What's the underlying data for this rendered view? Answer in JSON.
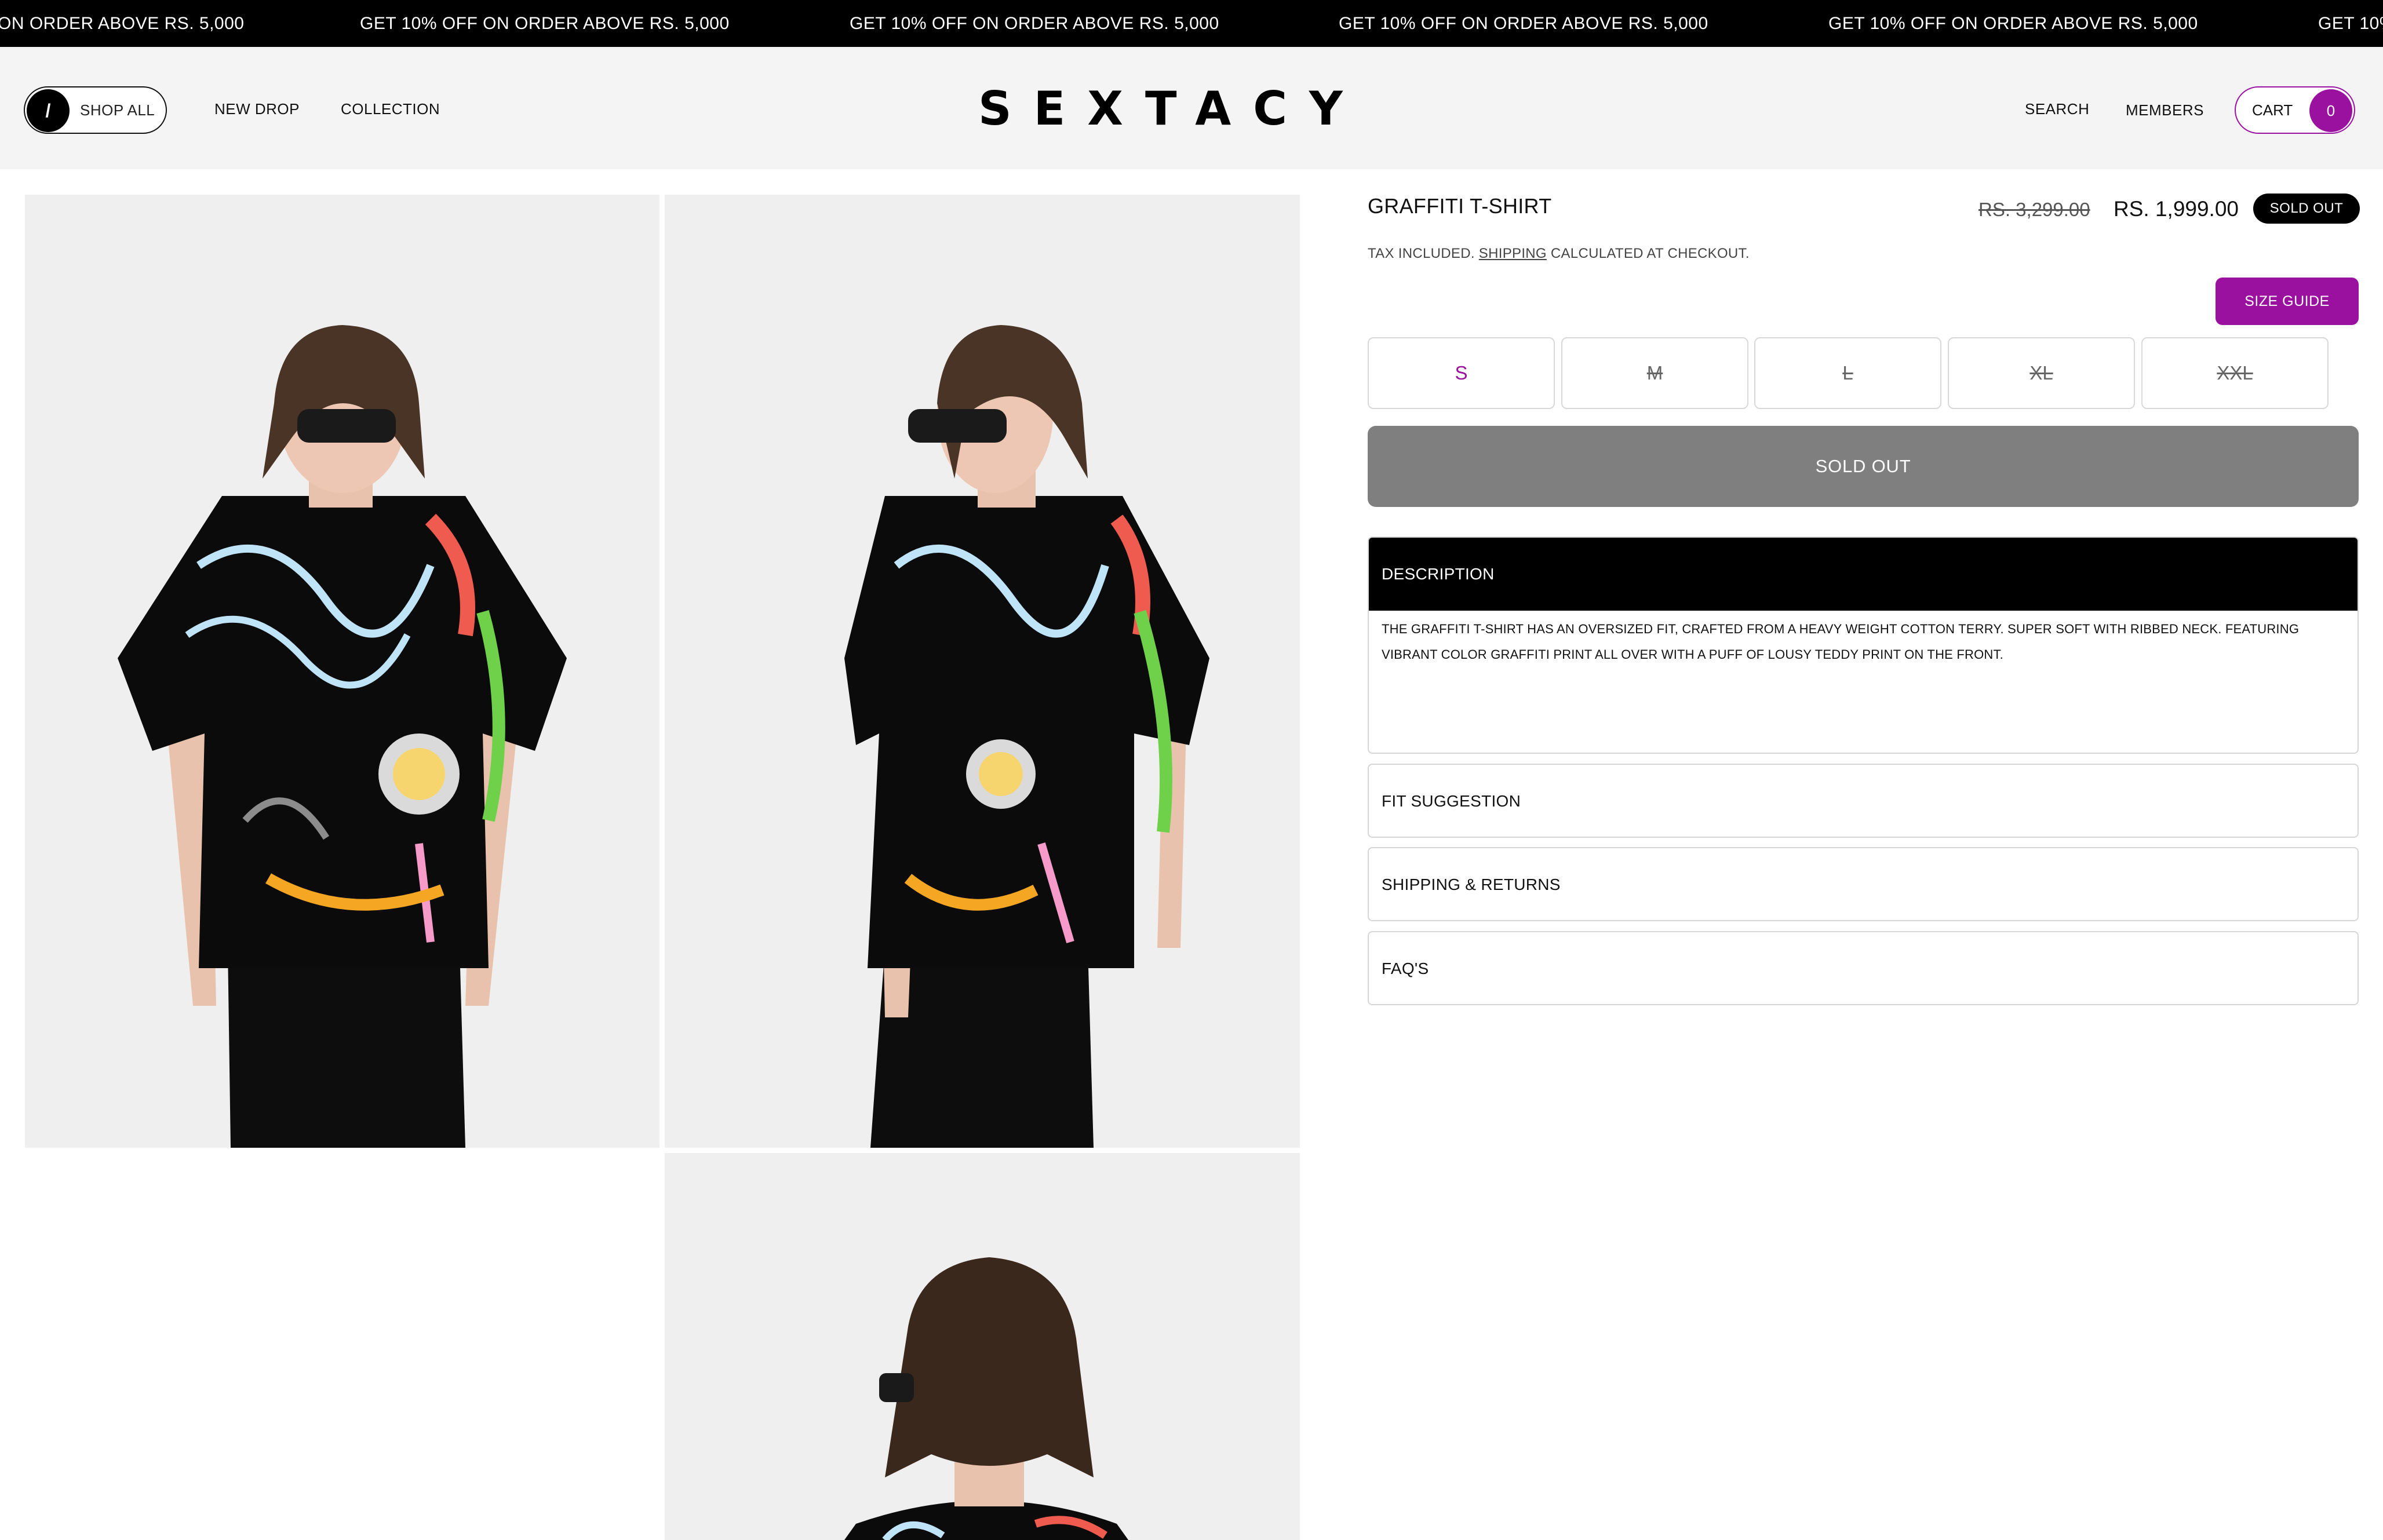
{
  "announcement": {
    "items": [
      "ON ORDER ABOVE RS. 5,000",
      "GET 10% OFF ON ORDER ABOVE RS. 5,000",
      "GET 10% OFF ON ORDER ABOVE RS. 5,000",
      "GET 10% OFF ON ORDER ABOVE RS. 5,000",
      "GET 10% OFF ON ORDER ABOVE RS. 5,000",
      "GET 10%"
    ]
  },
  "header": {
    "shop_all_icon": "/",
    "shop_all_label": "SHOP ALL",
    "nav": [
      "NEW DROP",
      "COLLECTION"
    ],
    "logo": "SEXTACY",
    "search_label": "SEARCH",
    "members_label": "MEMBERS",
    "cart_label": "CART",
    "cart_count": "0"
  },
  "product": {
    "title": "GRAFFITI T-SHIRT",
    "price_old": "RS. 3,299.00",
    "price_new": "RS. 1,999.00",
    "badge": "SOLD OUT",
    "tax_prefix": "TAX INCLUDED.",
    "tax_link": "SHIPPING",
    "tax_suffix": "CALCULATED AT CHECKOUT.",
    "size_guide_label": "SIZE GUIDE",
    "sizes": [
      "S",
      "M",
      "L",
      "XL",
      "XXL"
    ],
    "selected_size": "S",
    "sold_out_button": "SOLD OUT"
  },
  "accordion": {
    "description_title": "DESCRIPTION",
    "description_line1": "THE GRAFFITI T-SHIRT HAS AN OVERSIZED FIT, CRAFTED FROM A HEAVY WEIGHT COTTON TERRY. SUPER SOFT WITH RIBBED NECK. FEATURING",
    "description_line2": "VIBRANT COLOR GRAFFITI PRINT ALL OVER WITH A PUFF OF LOUSY TEDDY PRINT ON THE FRONT.",
    "fit_title": "FIT SUGGESTION",
    "shipping_title": "SHIPPING & RETURNS",
    "faq_title": "FAQ'S"
  },
  "colors": {
    "accent": "#9b119f",
    "announce_bg": "#000000",
    "header_bg": "#f4f4f4",
    "sold_out_bg": "#7f7f7f"
  }
}
